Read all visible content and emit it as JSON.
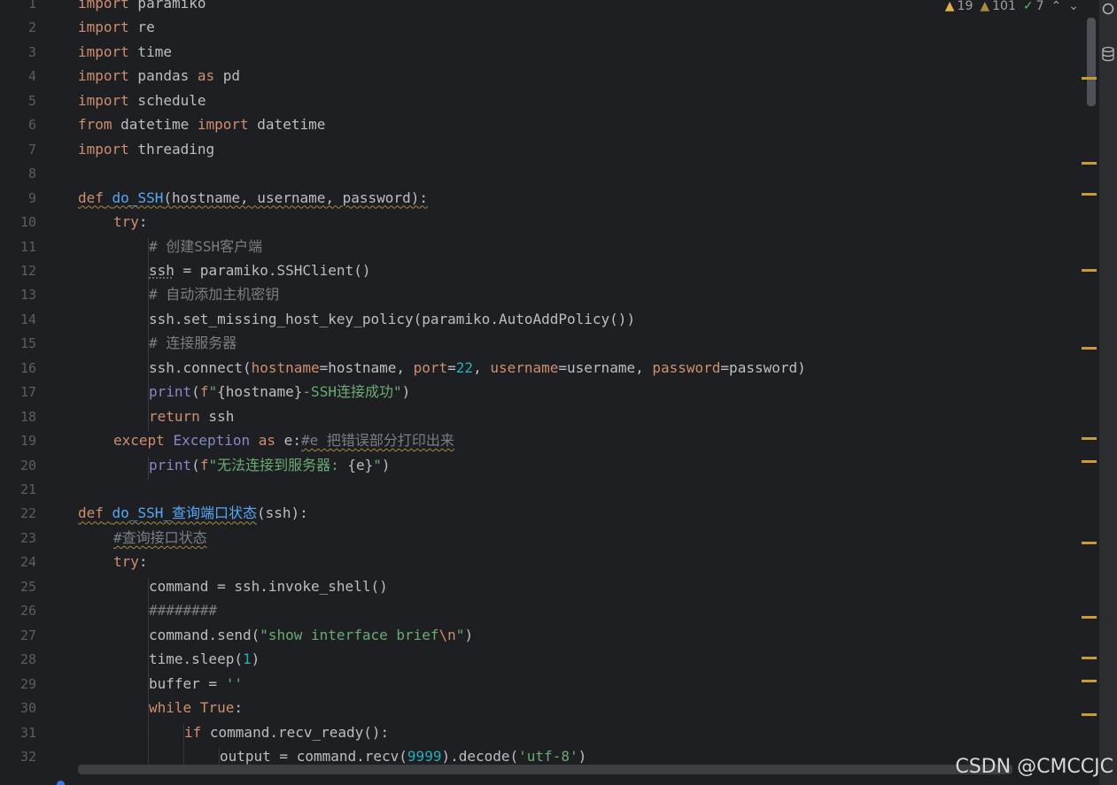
{
  "inspections": {
    "warnings": "19",
    "weak_warnings": "101",
    "typos": "7"
  },
  "lines": [
    {
      "n": "1",
      "indent": 0,
      "tokens": [
        [
          "kw",
          "import"
        ],
        [
          "t",
          " paramiko"
        ]
      ]
    },
    {
      "n": "2",
      "indent": 0,
      "tokens": [
        [
          "kw",
          "import"
        ],
        [
          "t",
          " re"
        ]
      ]
    },
    {
      "n": "3",
      "indent": 0,
      "tokens": [
        [
          "kw",
          "import"
        ],
        [
          "t",
          " time"
        ]
      ]
    },
    {
      "n": "4",
      "indent": 0,
      "tokens": [
        [
          "kw",
          "import"
        ],
        [
          "t",
          " pandas "
        ],
        [
          "kw",
          "as"
        ],
        [
          "t",
          " pd"
        ]
      ]
    },
    {
      "n": "5",
      "indent": 0,
      "tokens": [
        [
          "kw",
          "import"
        ],
        [
          "t",
          " schedule"
        ]
      ]
    },
    {
      "n": "6",
      "indent": 0,
      "tokens": [
        [
          "kw",
          "from"
        ],
        [
          "t",
          " datetime "
        ],
        [
          "kw",
          "import"
        ],
        [
          "t",
          " datetime"
        ]
      ]
    },
    {
      "n": "7",
      "indent": 0,
      "tokens": [
        [
          "kw",
          "import"
        ],
        [
          "t",
          " threading"
        ]
      ]
    },
    {
      "n": "8",
      "indent": 0,
      "tokens": []
    },
    {
      "n": "9",
      "indent": 0,
      "tokens": [
        [
          "kwsq",
          "def"
        ],
        [
          "tsq",
          " "
        ],
        [
          "fnsq",
          "do_SSH"
        ],
        [
          "tsq",
          "(hostname, username, password):"
        ]
      ]
    },
    {
      "n": "10",
      "indent": 1,
      "tokens": [
        [
          "kw",
          "try"
        ],
        [
          "t",
          ":"
        ]
      ]
    },
    {
      "n": "11",
      "indent": 2,
      "tokens": [
        [
          "cm",
          "# 创建SSH客户端"
        ]
      ]
    },
    {
      "n": "12",
      "indent": 2,
      "tokens": [
        [
          "tul",
          "ssh"
        ],
        [
          "t",
          " = paramiko.SSHClient()"
        ]
      ]
    },
    {
      "n": "13",
      "indent": 2,
      "tokens": [
        [
          "cm",
          "# 自动添加主机密钥"
        ]
      ]
    },
    {
      "n": "14",
      "indent": 2,
      "tokens": [
        [
          "t",
          "ssh.set_missing_host_key_policy(paramiko.AutoAddPolicy())"
        ]
      ]
    },
    {
      "n": "15",
      "indent": 2,
      "tokens": [
        [
          "cm",
          "# 连接服务器"
        ]
      ]
    },
    {
      "n": "16",
      "indent": 2,
      "tokens": [
        [
          "t",
          "ssh.connect("
        ],
        [
          "kw",
          "hostname"
        ],
        [
          "t",
          "=hostname, "
        ],
        [
          "kw",
          "port"
        ],
        [
          "t",
          "="
        ],
        [
          "num",
          "22"
        ],
        [
          "t",
          ", "
        ],
        [
          "kw",
          "username"
        ],
        [
          "t",
          "=username, "
        ],
        [
          "kw",
          "password"
        ],
        [
          "t",
          "=password)"
        ]
      ]
    },
    {
      "n": "17",
      "indent": 2,
      "tokens": [
        [
          "bi",
          "print"
        ],
        [
          "t",
          "("
        ],
        [
          "kw",
          "f"
        ],
        [
          "str",
          "\""
        ],
        [
          "t",
          "{hostname}"
        ],
        [
          "str",
          "-SSH连接成功\""
        ],
        [
          "t",
          ")"
        ]
      ]
    },
    {
      "n": "18",
      "indent": 2,
      "tokens": [
        [
          "kw",
          "return"
        ],
        [
          "t",
          " ssh"
        ]
      ]
    },
    {
      "n": "19",
      "indent": 1,
      "tokens": [
        [
          "kw",
          "except"
        ],
        [
          "t",
          " "
        ],
        [
          "bi",
          "Exception"
        ],
        [
          "t",
          " "
        ],
        [
          "kw",
          "as"
        ],
        [
          "t",
          " e:"
        ],
        [
          "cmsq",
          "#e 把错误部分打印出来"
        ]
      ]
    },
    {
      "n": "20",
      "indent": 2,
      "tokens": [
        [
          "bi",
          "print"
        ],
        [
          "t",
          "("
        ],
        [
          "kw",
          "f"
        ],
        [
          "str",
          "\"无法连接到服务器: "
        ],
        [
          "t",
          "{e}"
        ],
        [
          "str",
          "\""
        ],
        [
          "t",
          ")"
        ]
      ]
    },
    {
      "n": "21",
      "indent": 0,
      "tokens": []
    },
    {
      "n": "22",
      "indent": 0,
      "tokens": [
        [
          "kwsq",
          "def"
        ],
        [
          "tsq",
          " "
        ],
        [
          "fnsq",
          "do_SSH_查询端口状态"
        ],
        [
          "t",
          "(ssh):"
        ]
      ]
    },
    {
      "n": "23",
      "indent": 1,
      "tokens": [
        [
          "cmsq",
          "#查询接口状态"
        ]
      ]
    },
    {
      "n": "24",
      "indent": 1,
      "tokens": [
        [
          "kw",
          "try"
        ],
        [
          "t",
          ":"
        ]
      ]
    },
    {
      "n": "25",
      "indent": 2,
      "tokens": [
        [
          "t",
          "command = ssh.invoke_shell()"
        ]
      ]
    },
    {
      "n": "26",
      "indent": 2,
      "tokens": [
        [
          "cm",
          "########"
        ]
      ]
    },
    {
      "n": "27",
      "indent": 2,
      "tokens": [
        [
          "t",
          "command.send("
        ],
        [
          "str",
          "\"show interface brief"
        ],
        [
          "kw",
          "\\n"
        ],
        [
          "str",
          "\""
        ],
        [
          "t",
          ")"
        ]
      ]
    },
    {
      "n": "28",
      "indent": 2,
      "tokens": [
        [
          "t",
          "time.sleep("
        ],
        [
          "num",
          "1"
        ],
        [
          "t",
          ")"
        ]
      ]
    },
    {
      "n": "29",
      "indent": 2,
      "tokens": [
        [
          "t",
          "buffer = "
        ],
        [
          "str",
          "''"
        ]
      ]
    },
    {
      "n": "30",
      "indent": 2,
      "tokens": [
        [
          "kw",
          "while"
        ],
        [
          "t",
          " "
        ],
        [
          "kw",
          "True"
        ],
        [
          "t",
          ":"
        ]
      ]
    },
    {
      "n": "31",
      "indent": 3,
      "tokens": [
        [
          "kw",
          "if"
        ],
        [
          "t",
          " command.recv_ready():"
        ]
      ]
    },
    {
      "n": "32",
      "indent": 4,
      "tokens": [
        [
          "t",
          "output = command.recv("
        ],
        [
          "num",
          "9999"
        ],
        [
          "t",
          ").decode("
        ],
        [
          "str",
          "'utf-8'"
        ],
        [
          "t",
          ")"
        ]
      ]
    }
  ],
  "watermark": "CSDN @CMCCJC"
}
